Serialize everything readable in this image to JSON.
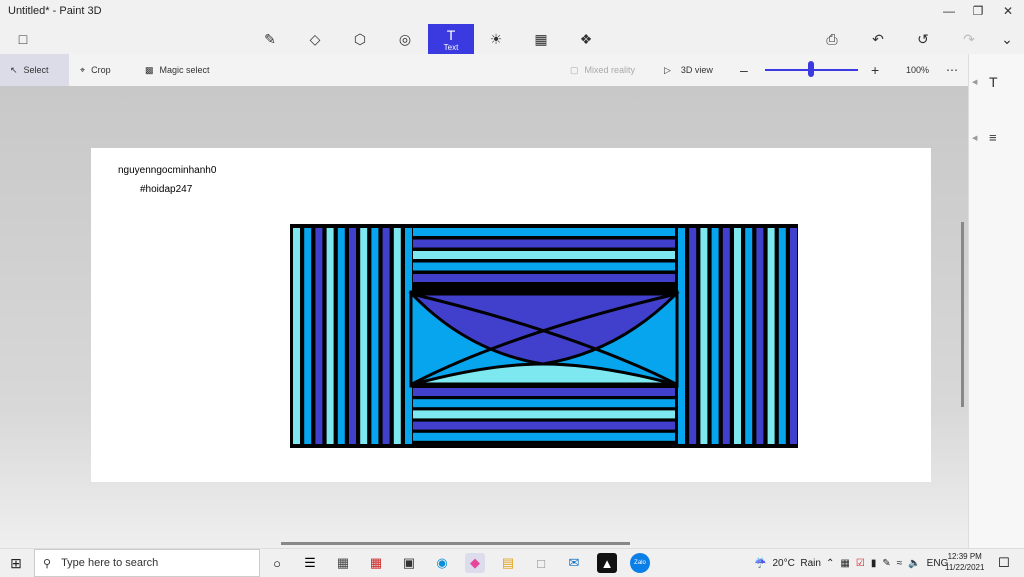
{
  "window": {
    "title": "Untitled* - Paint 3D"
  },
  "tools": {
    "active_label": "Text"
  },
  "toolbar": {
    "select": "Select",
    "crop": "Crop",
    "magic_select": "Magic select",
    "mixed_reality": "Mixed reality",
    "view_3d": "3D view",
    "zoom": "100%",
    "zoom_level_fraction": 0.5
  },
  "canvas": {
    "text_line1": "nguyenngocminhanh0",
    "text_line2": "#hoidap247",
    "colors": {
      "cyan": "#7de8ef",
      "sky": "#06a5ee",
      "indigo": "#4040cc",
      "outline": "#000000"
    }
  },
  "taskbar": {
    "search_placeholder": "Type here to search",
    "zalo": "Zalo",
    "weather": "20°C  Rain",
    "lang": "ENG",
    "time": "12:39 PM",
    "date": "11/22/2021"
  }
}
